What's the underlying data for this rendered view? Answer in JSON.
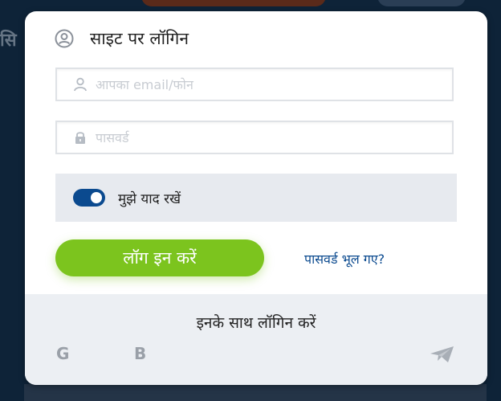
{
  "background": {
    "left_text": "सि"
  },
  "login_card": {
    "title": "साइट पर लॉगिन",
    "email": {
      "placeholder": "आपका email/फोन",
      "value": ""
    },
    "password": {
      "placeholder": "पासवर्ड",
      "value": ""
    },
    "remember_me": {
      "label": "मुझे याद रखें",
      "checked": true
    },
    "login_button_label": "लॉग इन करें",
    "forgot_password_label": "पासवर्ड भूल गए?"
  },
  "social": {
    "title": "इनके साथ लॉगिन करें",
    "providers": [
      {
        "name": "google",
        "glyph": "G"
      },
      {
        "name": "blogger",
        "glyph": "B"
      },
      {
        "name": "telegram",
        "glyph": ""
      }
    ]
  },
  "colors": {
    "page_background": "#0e2338",
    "accent_green": "#7cc41e",
    "toggle_blue": "#0b4a8f",
    "link_blue": "#0b4a8f",
    "muted_icon": "#9aa0a8"
  }
}
